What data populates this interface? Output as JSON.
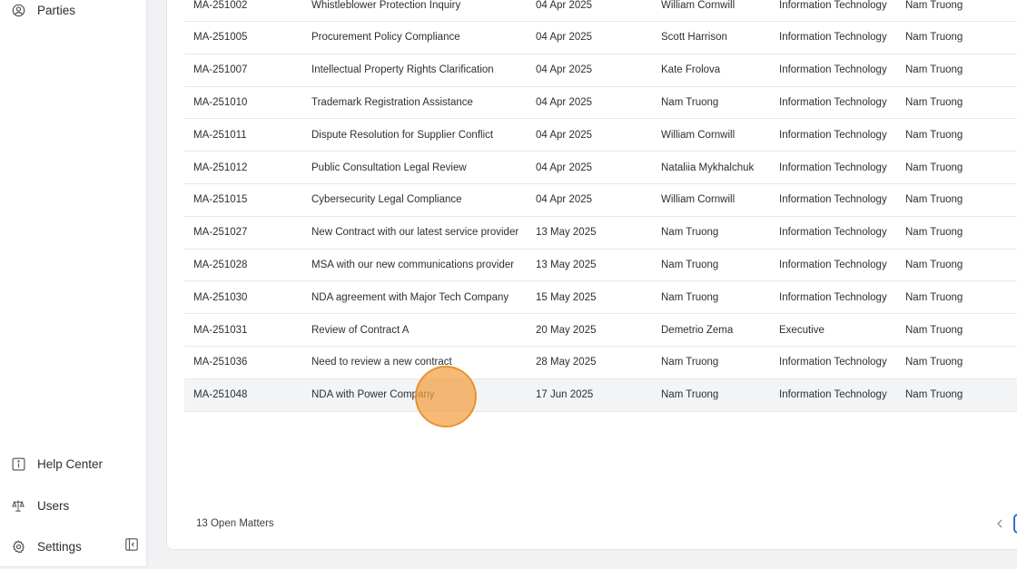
{
  "sidebar": {
    "items": [
      {
        "label": "Parties",
        "icon": "user-circle-icon"
      },
      {
        "label": "Help Center",
        "icon": "info-icon"
      },
      {
        "label": "Users",
        "icon": "scales-icon"
      },
      {
        "label": "Settings",
        "icon": "gear-icon"
      }
    ],
    "collapse_icon": "sidebar-collapse-icon"
  },
  "matters": {
    "rows": [
      {
        "id": "MA-251002",
        "title": "Whistleblower Protection Inquiry",
        "date": "04 Apr 2025",
        "owner": "William Cornwill",
        "department": "Information Technology",
        "assignee": "Nam Truong"
      },
      {
        "id": "MA-251005",
        "title": "Procurement Policy Compliance",
        "date": "04 Apr 2025",
        "owner": "Scott Harrison",
        "department": "Information Technology",
        "assignee": "Nam Truong"
      },
      {
        "id": "MA-251007",
        "title": "Intellectual Property Rights Clarification",
        "date": "04 Apr 2025",
        "owner": "Kate Frolova",
        "department": "Information Technology",
        "assignee": "Nam Truong"
      },
      {
        "id": "MA-251010",
        "title": "Trademark Registration Assistance",
        "date": "04 Apr 2025",
        "owner": "Nam Truong",
        "department": "Information Technology",
        "assignee": "Nam Truong"
      },
      {
        "id": "MA-251011",
        "title": "Dispute Resolution for Supplier Conflict",
        "date": "04 Apr 2025",
        "owner": "William Cornwill",
        "department": "Information Technology",
        "assignee": "Nam Truong"
      },
      {
        "id": "MA-251012",
        "title": "Public Consultation Legal Review",
        "date": "04 Apr 2025",
        "owner": "Nataliia Mykhalchuk",
        "department": "Information Technology",
        "assignee": "Nam Truong"
      },
      {
        "id": "MA-251015",
        "title": "Cybersecurity Legal Compliance",
        "date": "04 Apr 2025",
        "owner": "William Cornwill",
        "department": "Information Technology",
        "assignee": "Nam Truong"
      },
      {
        "id": "MA-251027",
        "title": "New Contract with our latest service provider",
        "date": "13 May 2025",
        "owner": "Nam Truong",
        "department": "Information Technology",
        "assignee": "Nam Truong"
      },
      {
        "id": "MA-251028",
        "title": "MSA with our new communications provider",
        "date": "13 May 2025",
        "owner": "Nam Truong",
        "department": "Information Technology",
        "assignee": "Nam Truong"
      },
      {
        "id": "MA-251030",
        "title": "NDA agreement with Major Tech Company",
        "date": "15 May 2025",
        "owner": "Nam Truong",
        "department": "Information Technology",
        "assignee": "Nam Truong"
      },
      {
        "id": "MA-251031",
        "title": "Review of Contract A",
        "date": "20 May 2025",
        "owner": "Demetrio Zema",
        "department": "Executive",
        "assignee": "Nam Truong"
      },
      {
        "id": "MA-251036",
        "title": "Need to review a new contract",
        "date": "28 May 2025",
        "owner": "Nam Truong",
        "department": "Information Technology",
        "assignee": "Nam Truong"
      },
      {
        "id": "MA-251048",
        "title": "NDA with Power Company",
        "date": "17 Jun 2025",
        "owner": "Nam Truong",
        "department": "Information Technology",
        "assignee": "Nam Truong"
      }
    ]
  },
  "footer": {
    "count_label": "13 Open Matters",
    "prev_icon": "chevron-left-icon"
  },
  "colors": {
    "accent": "#2f6fd6",
    "cursor_highlight": "#f2a041",
    "row_hover": "#f3f4f6"
  }
}
